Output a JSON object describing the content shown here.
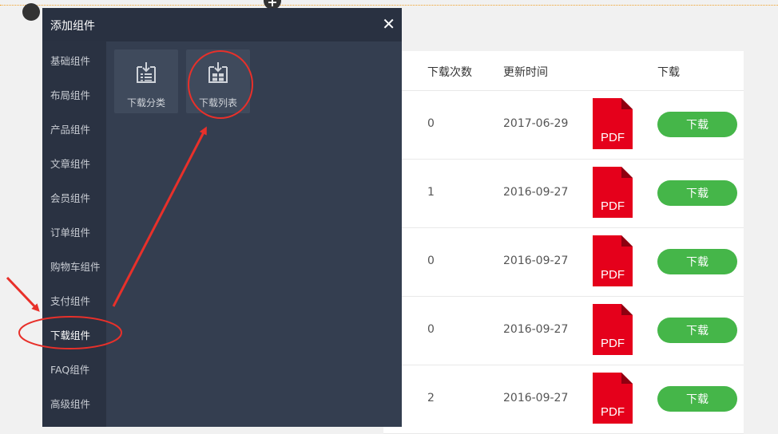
{
  "modal": {
    "title": "添加组件",
    "close_icon": "close-icon",
    "sidebar": [
      {
        "label": "基础组件"
      },
      {
        "label": "布局组件"
      },
      {
        "label": "产品组件"
      },
      {
        "label": "文章组件"
      },
      {
        "label": "会员组件"
      },
      {
        "label": "订单组件"
      },
      {
        "label": "购物车组件"
      },
      {
        "label": "支付组件"
      },
      {
        "label": "下载组件"
      },
      {
        "label": "FAQ组件"
      },
      {
        "label": "高级组件"
      }
    ],
    "selected_sidebar_item": "下载组件",
    "components": [
      {
        "label": "下载分类",
        "icon": "download-category-icon"
      },
      {
        "label": "下载列表",
        "icon": "download-list-icon"
      }
    ]
  },
  "table": {
    "headers": {
      "count": "下载次数",
      "updated": "更新时间",
      "download": "下载"
    },
    "rows": [
      {
        "count": "0",
        "date": "2017-06-29",
        "file_type": "PDF",
        "button": "下载"
      },
      {
        "count": "1",
        "date": "2016-09-27",
        "file_type": "PDF",
        "button": "下载"
      },
      {
        "count": "0",
        "date": "2016-09-27",
        "file_type": "PDF",
        "button": "下载"
      },
      {
        "count": "0",
        "date": "2016-09-27",
        "file_type": "PDF",
        "button": "下载"
      },
      {
        "count": "2",
        "date": "2016-09-27",
        "file_type": "PDF",
        "button": "下载"
      }
    ]
  },
  "colors": {
    "modal_bg": "#343e50",
    "modal_header": "#293141",
    "sidebar_bg": "#2a3242",
    "download_button": "#45b649",
    "pdf_red": "#e5001b",
    "annotation_red": "#e8302a"
  }
}
